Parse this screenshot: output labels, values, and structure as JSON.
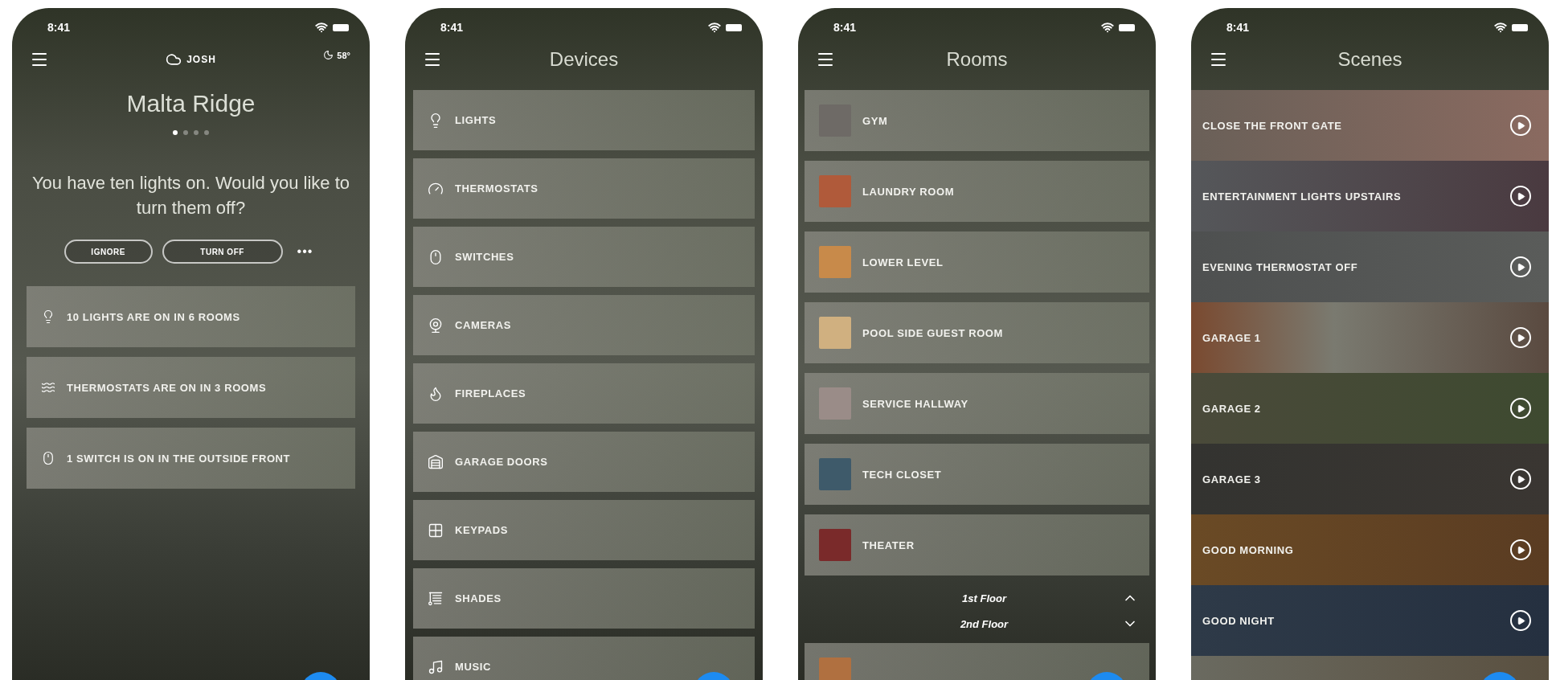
{
  "screens": [
    {
      "kind": "home",
      "time": "8:41",
      "user": "JOSH",
      "temperature": "58°",
      "title": "Malta Ridge",
      "pages": [
        {
          "selected": true
        },
        {
          "selected": false
        },
        {
          "selected": false
        },
        {
          "selected": false
        }
      ],
      "message": "You have ten lights on. Would you like to turn them off?",
      "actions": [
        "IGNORE",
        "TURN OFF"
      ],
      "more": "•••",
      "items": [
        {
          "kind": "light",
          "label": "10 LIGHTS ARE ON IN 6 ROOMS"
        },
        {
          "kind": "thermostat",
          "label": "THERMOSTATS ARE ON IN 3 ROOMS"
        },
        {
          "kind": "switch",
          "label": "1 SWITCH IS ON IN THE OUTSIDE FRONT"
        }
      ]
    },
    {
      "kind": "devices",
      "time": "8:41",
      "title": "Devices",
      "items": [
        {
          "kind": "light",
          "label": "LIGHTS"
        },
        {
          "kind": "thermostat",
          "label": "THERMOSTATS"
        },
        {
          "kind": "switch",
          "label": "SWITCHES"
        },
        {
          "kind": "camera",
          "label": "CAMERAS"
        },
        {
          "kind": "fireplace",
          "label": "FIREPLACES"
        },
        {
          "kind": "garage",
          "label": "GARAGE DOORS"
        },
        {
          "kind": "keypad",
          "label": "KEYPADS"
        },
        {
          "kind": "shade",
          "label": "SHADES"
        },
        {
          "kind": "music",
          "label": "MUSIC"
        }
      ]
    },
    {
      "kind": "rooms",
      "time": "8:41",
      "title": "Rooms",
      "items": [
        {
          "label": "GYM"
        },
        {
          "label": "LAUNDRY ROOM"
        },
        {
          "label": "LOWER LEVEL"
        },
        {
          "label": "POOL SIDE GUEST ROOM"
        },
        {
          "label": "SERVICE HALLWAY"
        },
        {
          "label": "TECH CLOSET"
        },
        {
          "label": "THEATER"
        }
      ],
      "floors": [
        "1st Floor",
        "2nd Floor"
      ]
    },
    {
      "kind": "scenes",
      "time": "8:41",
      "title": "Scenes",
      "items": [
        {
          "label": "CLOSE THE FRONT GATE"
        },
        {
          "label": "ENTERTAINMENT LIGHTS UPSTAIRS"
        },
        {
          "label": "EVENING THERMOSTAT OFF"
        },
        {
          "label": "GARAGE 1"
        },
        {
          "label": "GARAGE 2"
        },
        {
          "label": "GARAGE 3"
        },
        {
          "label": "GOOD MORNING"
        },
        {
          "label": "GOOD NIGHT"
        }
      ]
    }
  ]
}
